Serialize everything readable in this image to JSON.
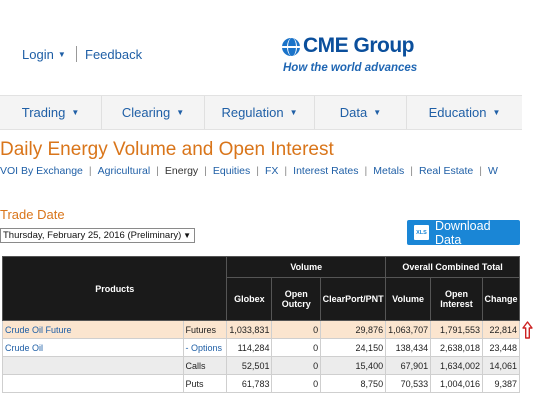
{
  "header": {
    "login_label": "Login",
    "feedback_label": "Feedback",
    "logo_text": "CME Group",
    "tagline": "How the world advances"
  },
  "nav": {
    "items": [
      {
        "label": "Trading"
      },
      {
        "label": "Clearing"
      },
      {
        "label": "Regulation"
      },
      {
        "label": "Data"
      },
      {
        "label": "Education"
      }
    ]
  },
  "page": {
    "title": "Daily Energy Volume and Open Interest"
  },
  "subnav": {
    "items": [
      "VOI By Exchange",
      "Agricultural",
      "Energy",
      "Equities",
      "FX",
      "Interest Rates",
      "Metals",
      "Real Estate",
      "W"
    ],
    "active": "Energy"
  },
  "trade_date": {
    "label": "Trade Date",
    "selected": "Thursday, February 25, 2016 (Preliminary)"
  },
  "download": {
    "icon_text": "XLS",
    "label": "Download Data"
  },
  "table": {
    "header_products": "Products",
    "group_volume": "Volume",
    "group_overall": "Overall Combined Total",
    "columns": [
      "Globex",
      "Open Outcry",
      "ClearPort/PNT",
      "Volume",
      "Open Interest",
      "Change"
    ],
    "rows": [
      {
        "product": "Crude Oil Future",
        "type": "Futures",
        "globex": "1,033,831",
        "outcry": "0",
        "clearport": "29,876",
        "volume": "1,063,707",
        "oi": "1,791,553",
        "change": "22,814"
      },
      {
        "product": "Crude Oil",
        "type": "- Options",
        "globex": "114,284",
        "outcry": "0",
        "clearport": "24,150",
        "volume": "138,434",
        "oi": "2,638,018",
        "change": "23,448"
      },
      {
        "product": "",
        "type": "Calls",
        "globex": "52,501",
        "outcry": "0",
        "clearport": "15,400",
        "volume": "67,901",
        "oi": "1,634,002",
        "change": "14,061"
      },
      {
        "product": "",
        "type": "Puts",
        "globex": "61,783",
        "outcry": "0",
        "clearport": "8,750",
        "volume": "70,533",
        "oi": "1,004,016",
        "change": "9,387"
      }
    ]
  },
  "colors": {
    "accent_orange": "#d9751a",
    "link_blue": "#1f5fa6",
    "button_blue": "#1a86d6",
    "highlight_row": "#fbe5cf",
    "arrow_red": "#cc2222"
  }
}
